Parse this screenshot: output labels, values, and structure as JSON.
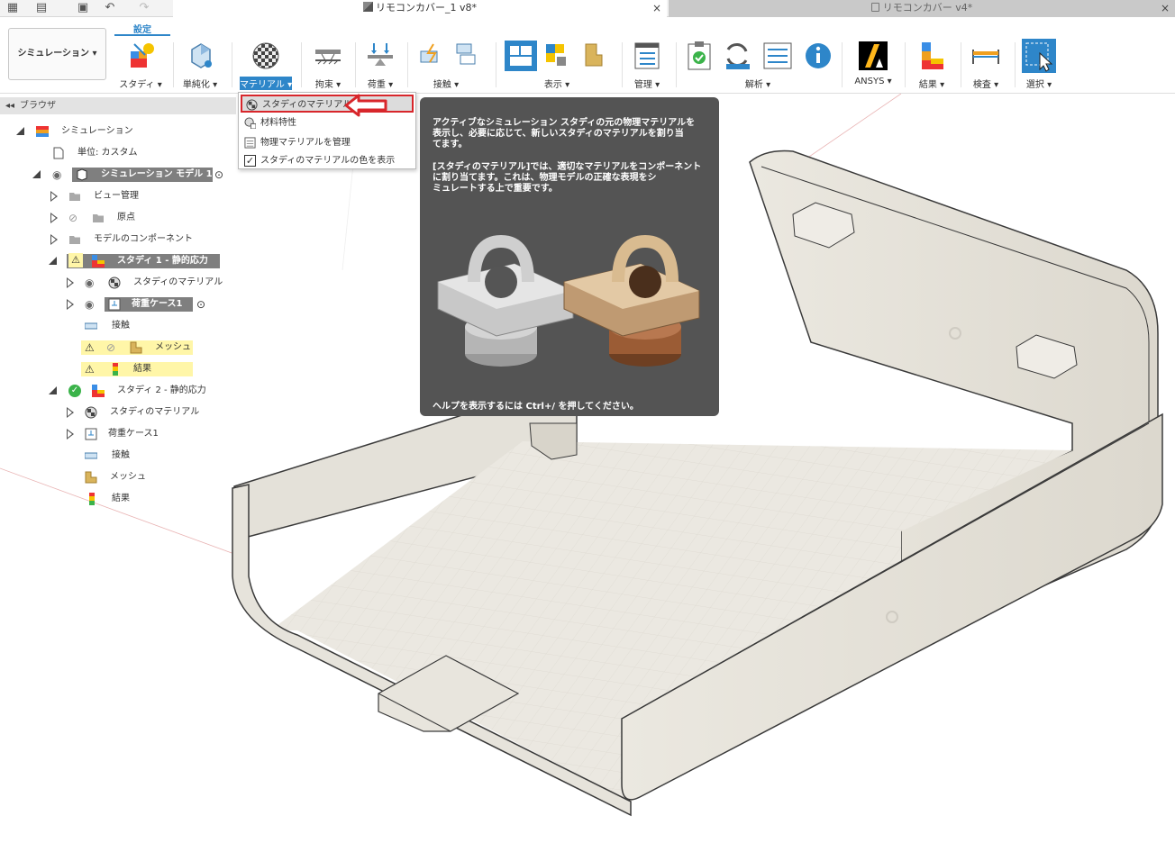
{
  "tabs": {
    "active_title": "リモコンカバー_1 v8*",
    "inactive_title": "リモコンカバー v4*",
    "close_glyph": "×"
  },
  "toolbar": {
    "workspace": "シミュレーション ▾",
    "settings_tab": "設定",
    "groups": {
      "study": "スタディ ▾",
      "simplify": "単純化 ▾",
      "materials": "マテリアル ▾",
      "constraints": "拘束 ▾",
      "loads": "荷重 ▾",
      "contacts": "接触 ▾",
      "display": "表示 ▾",
      "manage": "管理 ▾",
      "solve": "解析 ▾",
      "ansys": "ANSYS ▾",
      "results": "結果 ▾",
      "inspect": "検査 ▾",
      "select": "選択 ▾"
    }
  },
  "browser": {
    "title": "ブラウザ",
    "items": [
      {
        "label": "シミュレーション"
      },
      {
        "label": "単位: カスタム"
      },
      {
        "label": "シミュレーション モデル 1"
      },
      {
        "label": "ビュー管理"
      },
      {
        "label": "原点"
      },
      {
        "label": "モデルのコンポーネント"
      },
      {
        "label": "スタディ 1 - 静的応力"
      },
      {
        "label": "スタディのマテリアル"
      },
      {
        "label": "荷重ケース1"
      },
      {
        "label": "接触"
      },
      {
        "label": "メッシュ"
      },
      {
        "label": "結果"
      },
      {
        "label": "スタディ 2 - 静的応力"
      },
      {
        "label": "スタディのマテリアル"
      },
      {
        "label": "荷重ケース1"
      },
      {
        "label": "接触"
      },
      {
        "label": "メッシュ"
      },
      {
        "label": "結果"
      }
    ]
  },
  "menu": {
    "items": [
      {
        "label": "スタディのマテリアル"
      },
      {
        "label": "材料特性"
      },
      {
        "label": "物理マテリアルを管理"
      },
      {
        "label": "スタディのマテリアルの色を表示"
      }
    ]
  },
  "tooltip": {
    "line1": "アクティブなシミュレーション スタディの元の物理マテリアルを",
    "line2": "表示し、必要に応じて、新しいスタディのマテリアルを割り当",
    "line3": "てます。",
    "line4": "[スタディのマテリアル]では、適切なマテリアルをコンポーネント",
    "line5": "に割り当てます。これは、物理モデルの正確な表現をシ",
    "line6": "ミュレートする上で重要です。",
    "help": "ヘルプを表示するには Ctrl+/ を押してください。"
  },
  "colors": {
    "accent": "#2e86c9",
    "highlight_red": "#d8262b",
    "warning_yellow": "#fff6a8",
    "model_face": "#ece9e1",
    "grid_line": "#d9d5cc"
  }
}
